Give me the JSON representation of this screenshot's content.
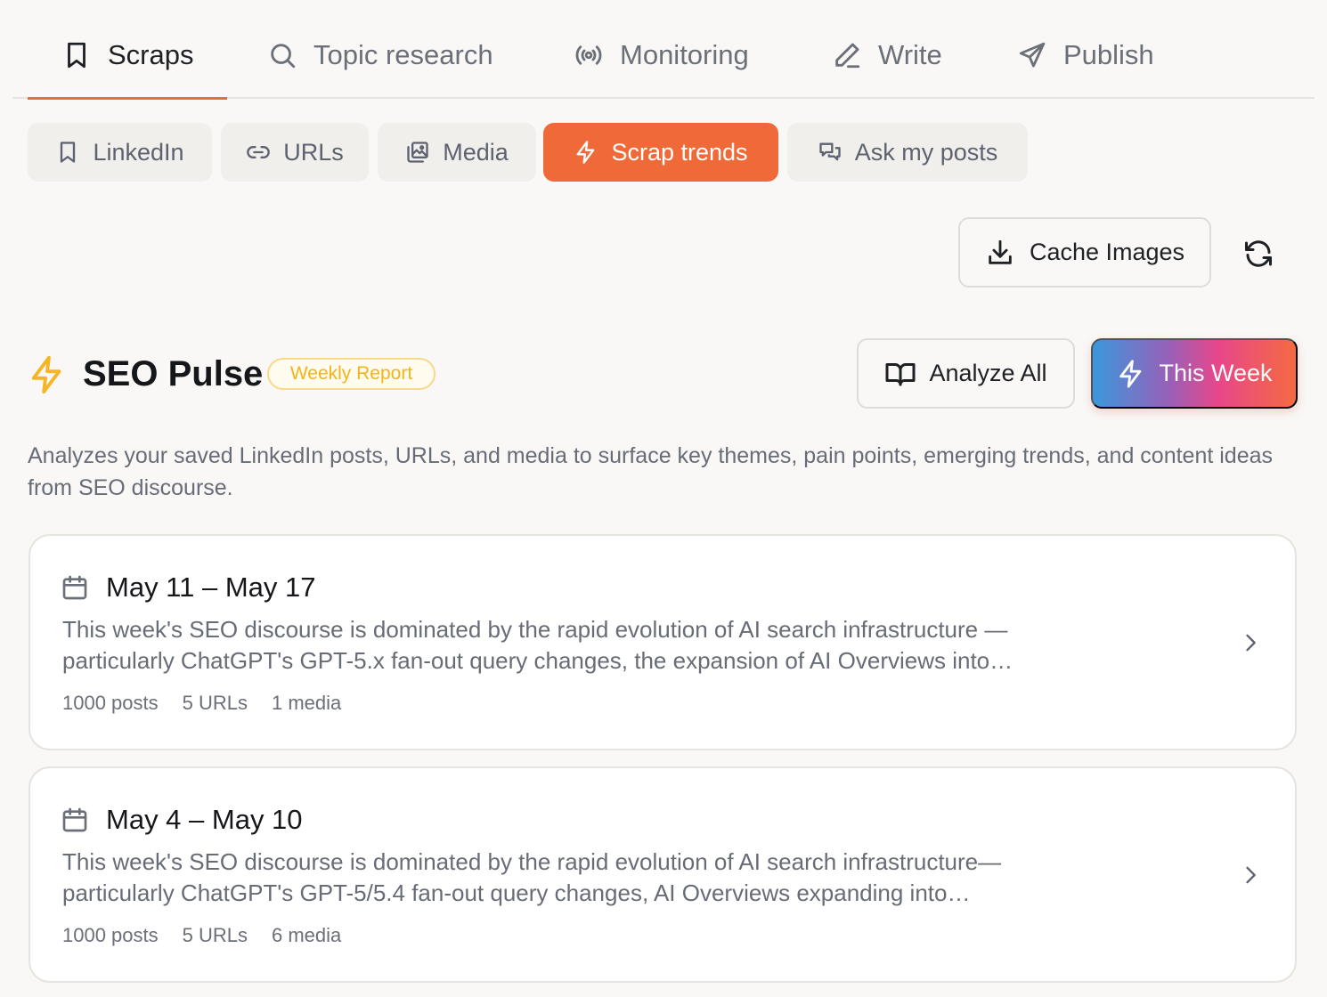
{
  "top_tabs": [
    {
      "label": "Scraps",
      "icon": "bookmark-icon",
      "active": true
    },
    {
      "label": "Topic research",
      "icon": "search-icon"
    },
    {
      "label": "Monitoring",
      "icon": "broadcast-icon"
    },
    {
      "label": "Write",
      "icon": "pencil-icon"
    },
    {
      "label": "Publish",
      "icon": "send-icon"
    }
  ],
  "sub_tabs": [
    {
      "label": "LinkedIn",
      "icon": "bookmark-icon"
    },
    {
      "label": "URLs",
      "icon": "link-icon"
    },
    {
      "label": "Media",
      "icon": "images-icon"
    },
    {
      "label": "Scrap trends",
      "icon": "lightning-icon",
      "active": true
    },
    {
      "label": "Ask my posts",
      "icon": "chat-icon"
    }
  ],
  "toolbar": {
    "cache_label": "Cache Images"
  },
  "header": {
    "title": "SEO Pulse",
    "badge": "Weekly Report",
    "analyze_label": "Analyze All",
    "this_week_label": "This Week"
  },
  "description": "Analyzes your saved LinkedIn posts, URLs, and media to surface key themes, pain points, emerging trends, and content ideas from SEO discourse.",
  "reports": [
    {
      "range": "May 11 – May 17",
      "summary": "This week's SEO discourse is dominated by the rapid evolution of AI search infrastructure — particularly ChatGPT's GPT-5.x fan-out query changes, the expansion of AI Overviews into…",
      "posts": "1000 posts",
      "urls": "5 URLs",
      "media": "1 media"
    },
    {
      "range": "May 4 – May 10",
      "summary": "This week's SEO discourse is dominated by the rapid evolution of AI search infrastructure—particularly ChatGPT's GPT-5/5.4 fan-out query changes, AI Overviews expanding into…",
      "posts": "1000 posts",
      "urls": "5 URLs",
      "media": "6 media"
    }
  ],
  "colors": {
    "accent": "#ef6a38",
    "badge_text": "#f2b41c",
    "background": "#f9f8f6"
  }
}
